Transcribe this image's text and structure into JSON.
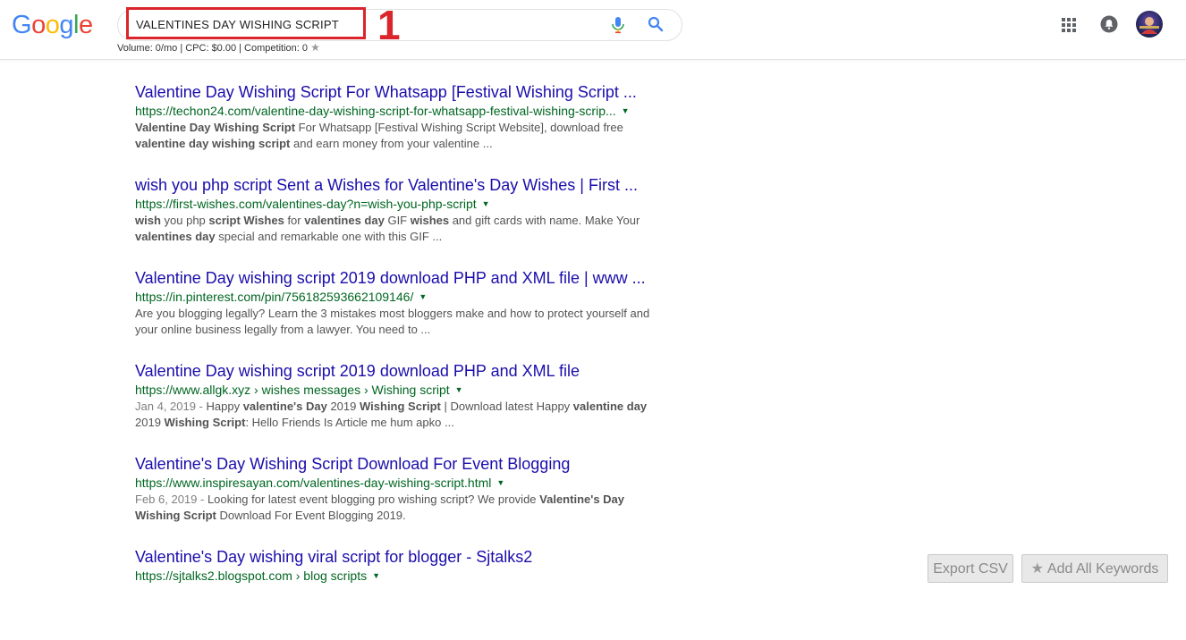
{
  "logo": {
    "letters": [
      "G",
      "o",
      "o",
      "g",
      "l",
      "e"
    ],
    "colors": [
      "#4285F4",
      "#EA4335",
      "#FBBC05",
      "#4285F4",
      "#34A853",
      "#EA4335"
    ]
  },
  "search": {
    "query": "VALENTINES DAY WISHING SCRIPT",
    "keyword_stats": "Volume: 0/mo | CPC: $0.00 | Competition: 0",
    "mic_icon": "mic-icon",
    "search_icon": "search-icon"
  },
  "annotation": {
    "label": "1",
    "color": "#d9252b"
  },
  "header_icons": [
    "apps-icon",
    "notifications-icon",
    "avatar"
  ],
  "results": [
    {
      "title": "Valentine Day Wishing Script For Whatsapp [Festival Wishing Script ...",
      "url": "https://techon24.com/valentine-day-wishing-script-for-whatsapp-festival-wishing-scrip...",
      "date": "",
      "snippet_html": "<b>Valentine Day Wishing Script</b> For Whatsapp [Festival Wishing Script Website], download free <b>valentine day wishing script</b> and earn money from your valentine ..."
    },
    {
      "title": "wish you php script Sent a Wishes for Valentine's Day Wishes | First ...",
      "url": "https://first-wishes.com/valentines-day?n=wish-you-php-script",
      "date": "",
      "snippet_html": "<b>wish</b> you php <b>script Wishes</b> for <b>valentines day</b> GIF <b>wishes</b> and gift cards with name. Make Your <b>valentines day</b> special and remarkable one with this GIF ..."
    },
    {
      "title": "Valentine Day wishing script 2019 download PHP and XML file | www ...",
      "url": "https://in.pinterest.com/pin/756182593662109146/",
      "date": "",
      "snippet_html": "Are you blogging legally? Learn the 3 mistakes most bloggers make and how to protect yourself and your online business legally from a lawyer. You need to ..."
    },
    {
      "title": "Valentine Day wishing script 2019 download PHP and XML file",
      "url": "https://www.allgk.xyz › wishes messages › Wishing script",
      "date": "Jan 4, 2019 - ",
      "snippet_html": "Happy <b>valentine's Day</b> 2019 <b>Wishing Script</b> | Download latest Happy <b>valentine day</b> 2019 <b>Wishing Script</b>: Hello Friends Is Article me hum apko ..."
    },
    {
      "title": "Valentine's Day Wishing Script Download For Event Blogging",
      "url": "https://www.inspiresayan.com/valentines-day-wishing-script.html",
      "date": "Feb 6, 2019 - ",
      "snippet_html": "Looking for latest event blogging pro wishing script? We provide <b>Valentine's Day Wishing Script</b> Download For Event Blogging 2019."
    },
    {
      "title": "Valentine's Day wishing viral script for blogger - Sjtalks2",
      "url": "https://sjtalks2.blogspot.com › blog scripts",
      "date": "",
      "snippet_html": ""
    }
  ],
  "buttons": {
    "export_csv": "Export CSV",
    "add_all_keywords": "Add All Keywords"
  }
}
